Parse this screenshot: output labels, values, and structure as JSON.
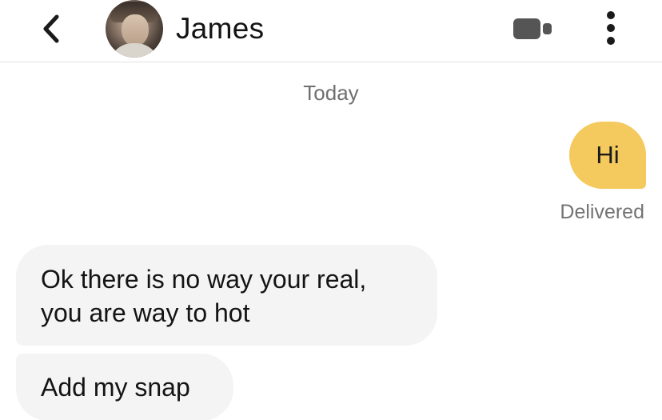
{
  "header": {
    "contact_name": "James",
    "back_icon": "chevron-left-icon",
    "video_icon": "video-camera-icon",
    "more_icon": "more-vertical-icon",
    "icon_color": "#1a1a1a",
    "video_icon_color": "#555555"
  },
  "conversation": {
    "date_label": "Today",
    "messages": [
      {
        "direction": "outgoing",
        "text": "Hi",
        "bubble_color": "#f4c95d"
      },
      {
        "direction": "incoming",
        "text": "Ok there is no way your real, you are way to hot",
        "bubble_color": "#f4f4f4"
      },
      {
        "direction": "incoming",
        "text": "Add my snap",
        "bubble_color": "#f4f4f4"
      }
    ],
    "outgoing_status": "Delivered"
  }
}
